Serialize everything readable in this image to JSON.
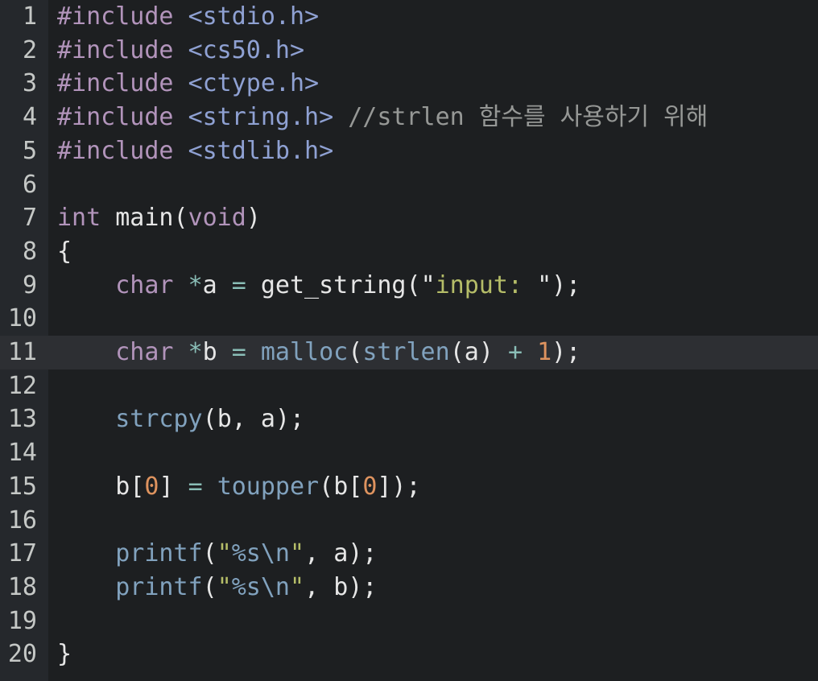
{
  "editor": {
    "language": "c",
    "active_line": 11,
    "colors": {
      "background": "#1d1f21",
      "gutter": "#25282c",
      "active_line": "#2d2f33",
      "keyword": "#b294bb",
      "function": "#81a2be",
      "string": "#b5bd68",
      "number": "#de935f",
      "comment": "#969896"
    },
    "line_numbers": [
      "1",
      "2",
      "3",
      "4",
      "5",
      "6",
      "7",
      "8",
      "9",
      "10",
      "11",
      "12",
      "13",
      "14",
      "15",
      "16",
      "17",
      "18",
      "19",
      "20"
    ],
    "lines": [
      {
        "tokens": {
          "inc": "#include",
          "sp": " ",
          "hdr": "<stdio.h>"
        }
      },
      {
        "tokens": {
          "inc": "#include",
          "sp": " ",
          "hdr": "<cs50.h>"
        }
      },
      {
        "tokens": {
          "inc": "#include",
          "sp": " ",
          "hdr": "<ctype.h>"
        }
      },
      {
        "tokens": {
          "inc": "#include",
          "sp": " ",
          "hdr": "<string.h>",
          "sp2": " ",
          "comment": "//strlen 함수를 사용하기 위해"
        }
      },
      {
        "tokens": {
          "inc": "#include",
          "sp": " ",
          "hdr": "<stdlib.h>"
        }
      },
      {
        "tokens": {}
      },
      {
        "tokens": {
          "kw": "int",
          "sp": " ",
          "id": "main",
          "p1": "(",
          "kw2": "void",
          "p2": ")"
        }
      },
      {
        "tokens": {
          "p": "{"
        }
      },
      {
        "tokens": {
          "ind": "    ",
          "kw": "char",
          "sp": " ",
          "op": "*",
          "id": "a",
          "sp2": " ",
          "op2": "=",
          "sp3": " ",
          "fn": "get_string",
          "p1": "(",
          "q1": "\"",
          "str": "input: ",
          "q2": "\"",
          "p2": ");"
        }
      },
      {
        "tokens": {}
      },
      {
        "tokens": {
          "ind": "    ",
          "kw": "char",
          "sp": " ",
          "op": "*",
          "id": "b",
          "sp2": " ",
          "op2": "=",
          "sp3": " ",
          "fn": "malloc",
          "p1": "(",
          "fn2": "strlen",
          "p2": "(",
          "id2": "a",
          "p3": ")",
          "sp4": " ",
          "op3": "+",
          "sp5": " ",
          "num": "1",
          "p4": ");"
        }
      },
      {
        "tokens": {}
      },
      {
        "tokens": {
          "ind": "    ",
          "fn": "strcpy",
          "p1": "(",
          "id": "b, a",
          "p2": ");"
        }
      },
      {
        "tokens": {}
      },
      {
        "tokens": {
          "ind": "    ",
          "id": "b",
          "p1": "[",
          "num": "0",
          "p2": "]",
          "sp": " ",
          "op": "=",
          "sp2": " ",
          "fn": "toupper",
          "p3": "(",
          "id2": "b",
          "p4": "[",
          "num2": "0",
          "p5": "]);"
        }
      },
      {
        "tokens": {}
      },
      {
        "tokens": {
          "ind": "    ",
          "fn": "printf",
          "p1": "(",
          "q1": "\"",
          "esc": "%s\\n",
          "q2": "\"",
          "p2": ", ",
          "id": "a",
          "p3": ");"
        }
      },
      {
        "tokens": {
          "ind": "    ",
          "fn": "printf",
          "p1": "(",
          "q1": "\"",
          "esc": "%s\\n",
          "q2": "\"",
          "p2": ", ",
          "id": "b",
          "p3": ");"
        }
      },
      {
        "tokens": {}
      },
      {
        "tokens": {
          "p": "}"
        }
      }
    ]
  }
}
